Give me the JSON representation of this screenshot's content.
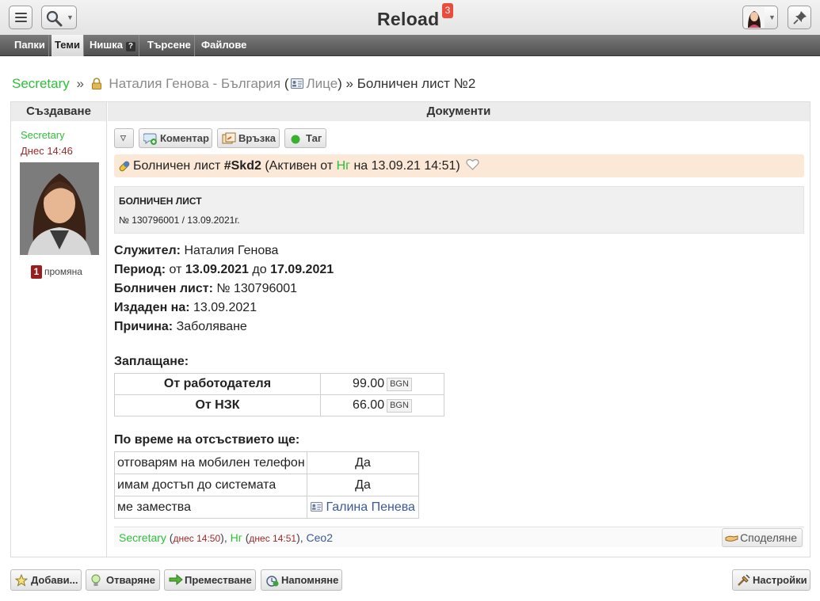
{
  "header": {
    "title": "Reload",
    "badge": "3"
  },
  "nav": {
    "tabs": [
      {
        "label": "Папки"
      },
      {
        "label": "Теми"
      },
      {
        "label": "Нишка"
      },
      {
        "label": "Търсене"
      },
      {
        "label": "Файлове"
      }
    ],
    "help_mark": "?"
  },
  "breadcrumb": {
    "root": "Secretary",
    "sep": "»",
    "person": "Наталия Генова - България",
    "open_paren": "(",
    "link": "Лице",
    "close": ") » Болничен лист №2"
  },
  "table": {
    "col_left": "Създаване",
    "col_right": "Документи"
  },
  "author": {
    "name": "Secretary",
    "when": "Днес 14:46",
    "changes_count": "1",
    "changes_label": "промяна"
  },
  "toolbar": {
    "comment": "Коментар",
    "link": "Връзка",
    "tag": "Таг"
  },
  "status": {
    "prefix": "Болничен лист",
    "code": "#Skd2",
    "active_pre": "(Активен от",
    "user": "Нг",
    "active_post": "на 13.09.21 14:51)"
  },
  "doc": {
    "title": "БОЛНИЧЕН ЛИСТ",
    "subtitle": "№ 130796001 / 13.09.2021г."
  },
  "fields": {
    "employee_label": "Служител:",
    "employee": "Наталия Генова",
    "period_label": "Период:",
    "period_from_word": "от",
    "period_from": "13.09.2021",
    "period_to_word": "до",
    "period_to": "17.09.2021",
    "sheet_label": "Болничен лист:",
    "sheet": "№ 130796001",
    "issued_label": "Издаден на:",
    "issued": "13.09.2021",
    "reason_label": "Причина:",
    "reason": "Заболяване",
    "payment_label": "Заплащане:",
    "absence_label": "По време на отсъствието ще:"
  },
  "payments": [
    {
      "payer": "От работодателя",
      "amount": "99.00",
      "currency": "BGN"
    },
    {
      "payer": "От НЗК",
      "amount": "66.00",
      "currency": "BGN"
    }
  ],
  "absence": [
    {
      "task": "отговарям на мобилен телефон",
      "value": "Да"
    },
    {
      "task": "имам достъп до системата",
      "value": "Да"
    },
    {
      "task": "ме замества",
      "value": "Галина Пенева"
    }
  ],
  "footer": {
    "u1": "Secretary",
    "d1": "днес 14:50",
    "u2": "Нг",
    "d2": "днес 14:51",
    "u3": "Сео2",
    "share": "Споделяне"
  },
  "bottom": {
    "add": "Добави...",
    "open": "Отваряне",
    "move": "Преместване",
    "remind": "Напомняне",
    "settings": "Настройки"
  }
}
